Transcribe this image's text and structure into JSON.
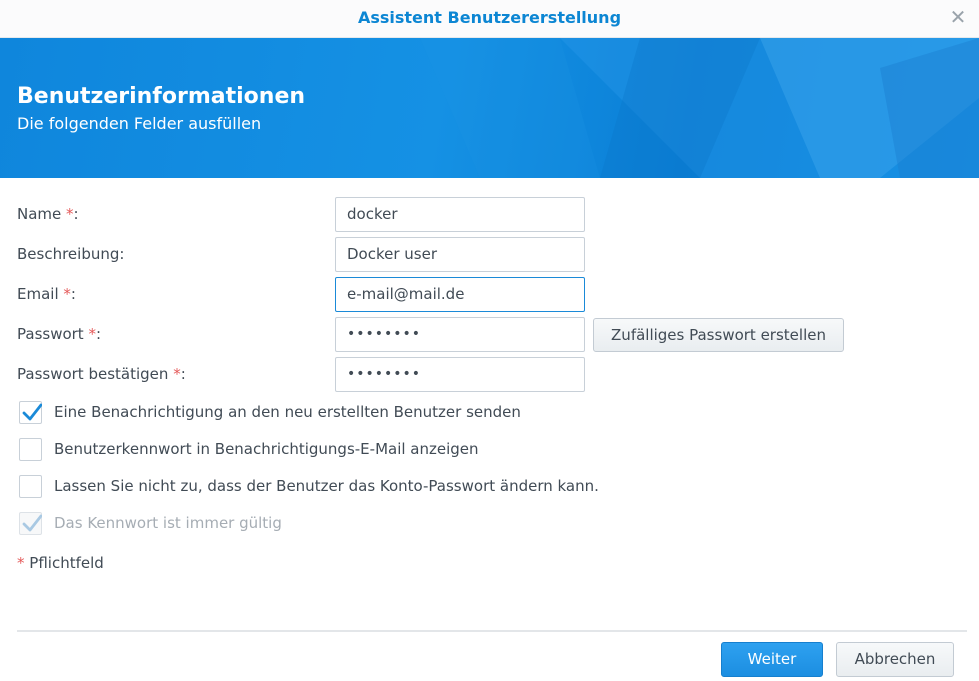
{
  "window": {
    "title": "Assistent Benutzererstellung",
    "close_icon": "close-icon"
  },
  "banner": {
    "title": "Benutzerinformationen",
    "subtitle": "Die folgenden Felder ausfüllen"
  },
  "form": {
    "required_marker": "*",
    "name": {
      "label": "Name",
      "suffix": ":",
      "value": "docker",
      "required": true
    },
    "description": {
      "label": "Beschreibung:",
      "value": "Docker user",
      "required": false
    },
    "email": {
      "label": "Email",
      "suffix": ":",
      "value": "e-mail@mail.de",
      "required": true,
      "focused": true
    },
    "password": {
      "label": "Passwort",
      "suffix": ":",
      "value": "••••••••",
      "required": true
    },
    "password_confirm": {
      "label": "Passwort bestätigen",
      "suffix": ":",
      "value": "••••••••",
      "required": true
    },
    "generate_password_label": "Zufälliges Passwort erstellen"
  },
  "options": [
    {
      "label": "Eine Benachrichtigung an den neu erstellten Benutzer senden",
      "checked": true,
      "disabled": false
    },
    {
      "label": "Benutzerkennwort in Benachrichtigungs-E-Mail anzeigen",
      "checked": false,
      "disabled": false
    },
    {
      "label": "Lassen Sie nicht zu, dass der Benutzer das Konto-Passwort ändern kann.",
      "checked": false,
      "disabled": false
    },
    {
      "label": "Das Kennwort ist immer gültig",
      "checked": true,
      "disabled": true
    }
  ],
  "required_note": "Pflichtfeld",
  "footer": {
    "next_label": "Weiter",
    "cancel_label": "Abbrechen"
  },
  "colors": {
    "accent": "#0c86d3",
    "banner": "#1591e4",
    "required": "#e45959",
    "primary_button": "#1c8ee1"
  }
}
